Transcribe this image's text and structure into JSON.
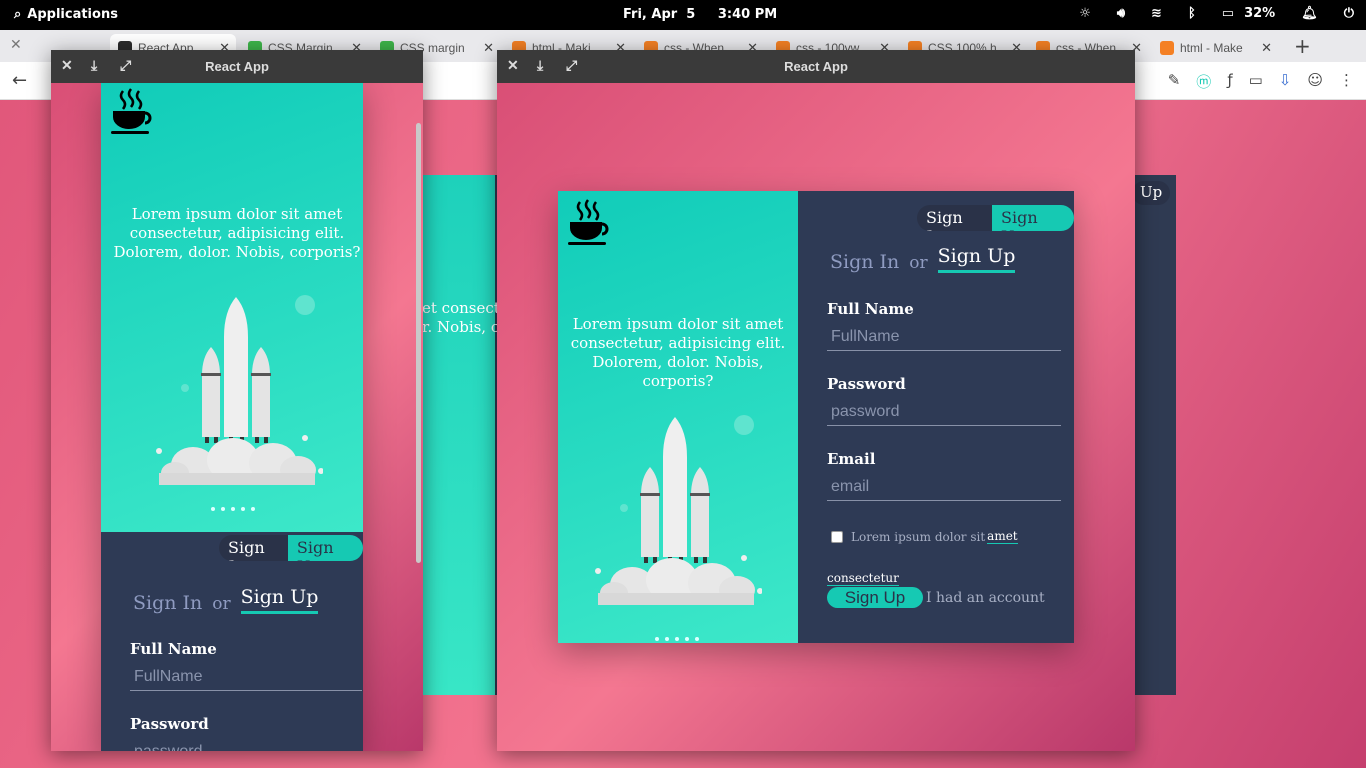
{
  "topbar": {
    "applications": "Applications",
    "clock": "Fri, Apr  5     3:40 PM",
    "battery": "32%"
  },
  "tabs": [
    {
      "label": "React App",
      "color": "#2b2b2b"
    },
    {
      "label": "CSS Margin",
      "color": "#3eb54a"
    },
    {
      "label": "CSS margin",
      "color": "#3eb54a"
    },
    {
      "label": "html - Maki",
      "color": "#f48024"
    },
    {
      "label": "css - When",
      "color": "#f48024"
    },
    {
      "label": "css - 100vw",
      "color": "#f48024"
    },
    {
      "label": "CSS 100% h",
      "color": "#f48024"
    },
    {
      "label": "css - When",
      "color": "#f48024"
    },
    {
      "label": "html - Make",
      "color": "#f48024"
    }
  ],
  "window_small": {
    "title": "React App"
  },
  "window_large": {
    "title": "React App"
  },
  "behind": {
    "text1": "et consect",
    "text2": "r. Nobis, c",
    "switch": "Up"
  },
  "hero": {
    "blurb": "Lorem ipsum dolor sit amet consectetur, adipisicing elit. Dolorem, dolor. Nobis, corporis?"
  },
  "switch": {
    "signin": "Sign In",
    "signup": "Sign Up"
  },
  "form": {
    "tab_signin": "Sign In",
    "tab_or": "or",
    "tab_signup": "Sign Up",
    "fullname_label": "Full Name",
    "fullname_placeholder": "FullName",
    "password_label": "Password",
    "password_placeholder": "password",
    "email_label": "Email",
    "email_placeholder": "email",
    "checkbox_text": "Lorem ipsum dolor sit",
    "checkbox_link": "amet",
    "checkbox_link2": "consectetur",
    "submit": "Sign Up",
    "alt_link": "I had an account"
  },
  "colors": {
    "accent": "#16c9b3",
    "panel": "#2e3a55",
    "pink": "#f47590"
  }
}
